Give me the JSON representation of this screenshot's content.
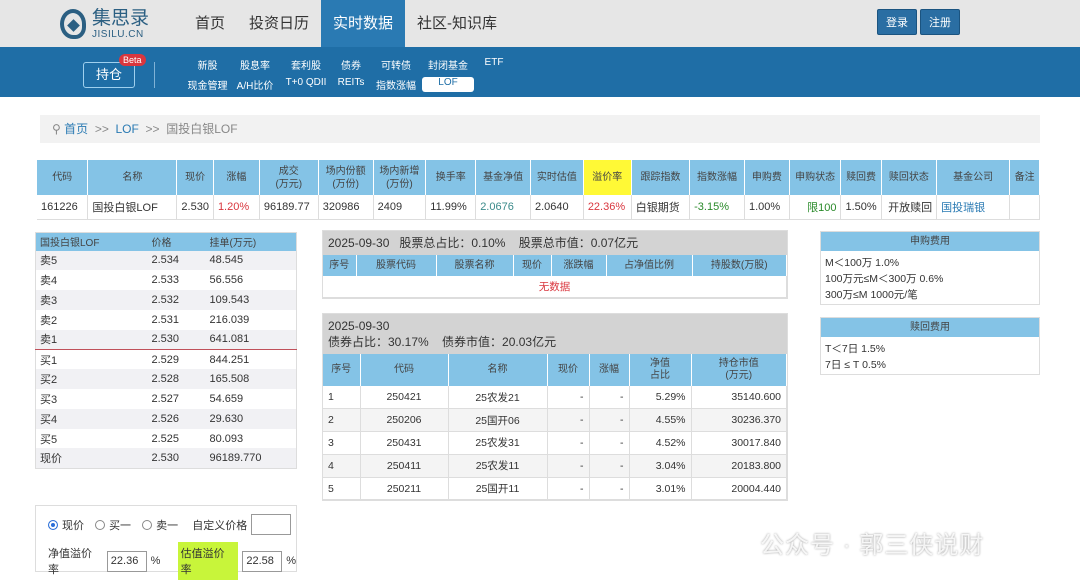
{
  "header": {
    "logo_cn": "集思录",
    "logo_en": "JISILU.CN",
    "nav": [
      "首页",
      "投资日历",
      "实时数据",
      "社区-知识库"
    ],
    "active_nav": "实时数据",
    "login": "登录",
    "register": "注册"
  },
  "subnav": {
    "holdings": "持仓",
    "beta": "Beta",
    "links": [
      "新股",
      "股息率",
      "套利股",
      "债券",
      "可转债",
      "封闭基金",
      "ETF",
      "现金管理",
      "A/H比价",
      "T+0 QDII",
      "REITs",
      "指数涨幅",
      "LOF"
    ],
    "active": "LOF"
  },
  "breadcrumb": {
    "home": "首页",
    "sep": ">>",
    "lof": "LOF",
    "current": "国投白银LOF"
  },
  "main_table": {
    "headers": [
      "代码",
      "名称",
      "现价",
      "涨幅",
      "成交\n(万元)",
      "场内份额\n(万份)",
      "场内新增\n(万份)",
      "换手率",
      "基金净值",
      "实时估值",
      "溢价率",
      "跟踪指数",
      "指数涨幅",
      "申购费",
      "申购状态",
      "赎回费",
      "赎回状态",
      "基金公司",
      "备注"
    ],
    "row": [
      "161226",
      "国投白银LOF",
      "2.530",
      "1.20%",
      "96189.77",
      "320986",
      "2409",
      "11.99%",
      "2.0676",
      "2.0640",
      "22.36%",
      "白银期货",
      "-3.15%",
      "1.00%",
      "限100",
      "1.50%",
      "开放赎回",
      "国投瑞银",
      ""
    ]
  },
  "orderbook": {
    "headers": [
      "国投白银LOF",
      "价格",
      "挂单(万元)"
    ],
    "rows": [
      [
        "卖5",
        "2.534",
        "48.545"
      ],
      [
        "卖4",
        "2.533",
        "56.556"
      ],
      [
        "卖3",
        "2.532",
        "109.543"
      ],
      [
        "卖2",
        "2.531",
        "216.039"
      ],
      [
        "卖1",
        "2.530",
        "641.081"
      ],
      [
        "买1",
        "2.529",
        "844.251"
      ],
      [
        "买2",
        "2.528",
        "165.508"
      ],
      [
        "买3",
        "2.527",
        "54.659"
      ],
      [
        "买4",
        "2.526",
        "29.630"
      ],
      [
        "买5",
        "2.525",
        "80.093"
      ],
      [
        "现价",
        "2.530",
        "96189.770"
      ]
    ]
  },
  "calc": {
    "opt_price": "现价",
    "opt_buy1": "买一",
    "opt_sell1": "卖一",
    "custom_price": "自定义价格",
    "custom_value": "",
    "nav_premium_label": "净值溢价率",
    "nav_premium": "22.36",
    "est_premium_label": "估值溢价率",
    "est_premium": "22.58",
    "pct": "%"
  },
  "stocks": {
    "title": "2025-09-30   股票总占比：0.10%    股票总市值：0.07亿元",
    "headers": [
      "序号",
      "股票代码",
      "股票名称",
      "现价",
      "涨跌幅",
      "占净值比例",
      "持股数(万股)"
    ],
    "empty": "无数据"
  },
  "bonds": {
    "date": "2025-09-30",
    "summary": "债券占比：30.17%    债券市值：20.03亿元",
    "headers": [
      "序号",
      "代码",
      "名称",
      "现价",
      "涨幅",
      "净值\n占比",
      "持仓市值\n(万元)"
    ],
    "rows": [
      [
        "1",
        "250421",
        "25农发21",
        "-",
        "-",
        "5.29%",
        "35140.600"
      ],
      [
        "2",
        "250206",
        "25国开06",
        "-",
        "-",
        "4.55%",
        "30236.370"
      ],
      [
        "3",
        "250431",
        "25农发31",
        "-",
        "-",
        "4.52%",
        "30017.840"
      ],
      [
        "4",
        "250411",
        "25农发11",
        "-",
        "-",
        "3.04%",
        "20183.800"
      ],
      [
        "5",
        "250211",
        "25国开11",
        "-",
        "-",
        "3.01%",
        "20004.440"
      ]
    ]
  },
  "fees": {
    "sub_title": "申购费用",
    "sub_lines": [
      "M＜100万 1.0%",
      "100万元≤M＜300万 0.6%",
      "300万≤M 1000元/笔"
    ],
    "red_title": "赎回费用",
    "red_lines": [
      "T＜7日 1.5%",
      "7日 ≤ T 0.5%"
    ]
  },
  "watermark": "公众号 · 郭三侠说财"
}
